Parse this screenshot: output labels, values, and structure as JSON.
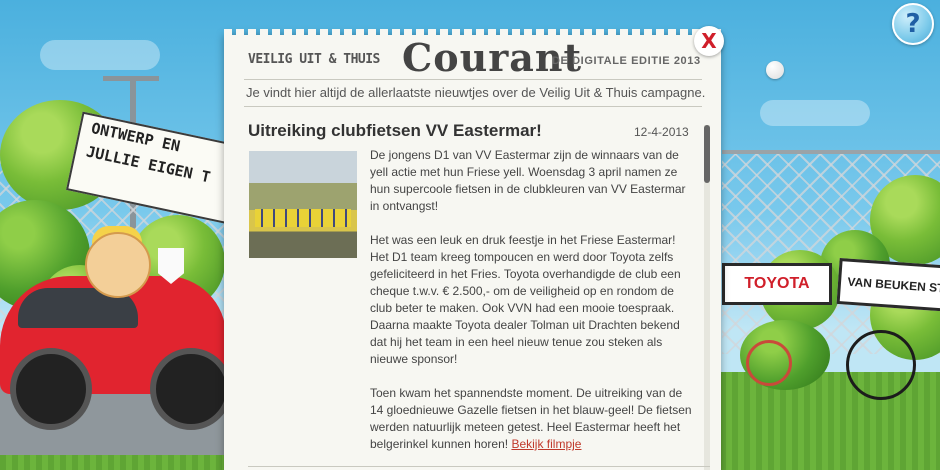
{
  "header": {
    "campaign_label": "VEILIG UIT & THUIS",
    "title": "Courant",
    "edition": "DE DIGITALE EDITIE 2013",
    "tagline": "Je vindt hier altijd de allerlaatste nieuwtjes over de Veilig Uit & Thuis campagne."
  },
  "article": {
    "title": "Uitreiking clubfietsen VV Eastermar!",
    "date": "12-4-2013",
    "paragraphs": [
      "De jongens D1 van VV Eastermar zijn de winnaars van de yell actie met hun Friese yell. Woensdag 3 april namen ze hun supercoole fietsen in de clubkleuren van VV Eastermar in ontvangst!",
      "Het was een leuk en druk feestje in het Friese Eastermar! Het D1 team kreeg tompoucen en werd door Toyota zelfs gefeliciteerd in het Fries. Toyota overhandigde de club een cheque t.w.v. € 2.500,- om de veiligheid op en rondom de club beter te maken. Ook VVN had een mooie toespraak. Daarna maakte Toyota dealer Tolman uit Drachten bekend dat hij het team in een heel nieuw tenue zou steken als nieuwe sponsor!",
      "Toen kwam het spannendste moment. De uitreiking van de 14 gloednieuwe Gazelle fietsen in het blauw-geel! De fietsen werden natuurlijk meteen getest. Heel Eastermar heeft het belgerinkel kunnen horen!"
    ],
    "video_link": "Bekijk filmpje"
  },
  "controls": {
    "close_label": "X",
    "help_label": "?"
  },
  "scene": {
    "banner_lines": [
      "ONTWERP EN",
      "JULLIE EIGEN T"
    ],
    "sign_toyota": "TOYOTA",
    "sign_vanbeuken": "VAN BEUKEN ST"
  },
  "colors": {
    "accent_red": "#d01f2a",
    "link": "#c0392b",
    "panel_bg": "#f7f7f2"
  }
}
